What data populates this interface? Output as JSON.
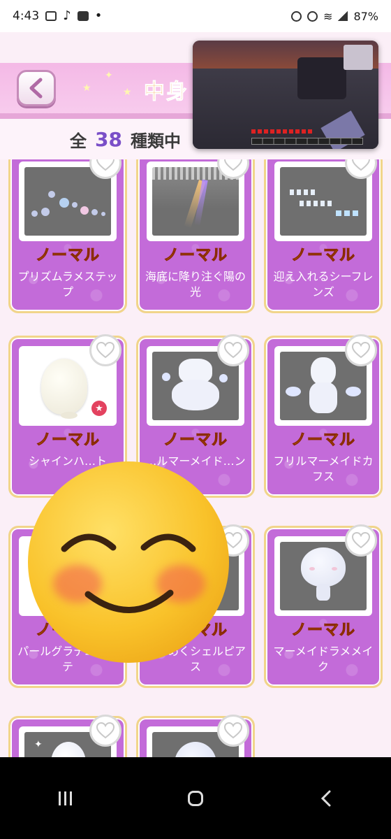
{
  "status_bar": {
    "time": "4:43",
    "battery": "87%",
    "icons": [
      "gallery-icon",
      "tiktok-icon",
      "youtube-icon",
      "dot-icon",
      "alarm-icon",
      "mute-icon",
      "wifi-icon",
      "signal-icon"
    ]
  },
  "header": {
    "title": "中身",
    "back_icon": "chevron-left-icon"
  },
  "count_row": {
    "prefix": "全",
    "total": "38",
    "suffix": "種類中"
  },
  "cards": [
    {
      "rarity": "ノーマル",
      "name": "プリズムラメステップ",
      "thumb": "bubbles"
    },
    {
      "rarity": "ノーマル",
      "name": "海底に降り注ぐ陽の光",
      "thumb": "light"
    },
    {
      "rarity": "ノーマル",
      "name": "迎え入れるシーフレンズ",
      "thumb": "fish"
    },
    {
      "rarity": "ノーマル",
      "name": "シャインハ…ト",
      "thumb": "egg",
      "favorite": true
    },
    {
      "rarity": "ノーマル",
      "name": "…ルマーメイド…ン",
      "thumb": "mermaid"
    },
    {
      "rarity": "ノーマル",
      "name": "フリルマーメイドカフス",
      "thumb": "cuffs"
    },
    {
      "rarity": "ノーマル",
      "name": "パールグラデエクステ",
      "thumb": "hidden"
    },
    {
      "rarity": "ノーマル",
      "name": "きらめくシェルピアス",
      "thumb": "hidden"
    },
    {
      "rarity": "ノーマル",
      "name": "マーメイドラメメイク",
      "thumb": "face"
    },
    {
      "rarity": "",
      "name": "",
      "thumb": "egg-sparkle"
    },
    {
      "rarity": "",
      "name": "",
      "thumb": "head"
    }
  ],
  "overlays": {
    "video": "minecraft-gameplay-overlay",
    "emoji": "smiling-face-emoji"
  },
  "nav": {
    "recent": "recent-apps-icon",
    "home": "home-icon",
    "back": "back-icon"
  },
  "colors": {
    "card_bg": "#c36bd9",
    "card_border": "#f1d58a",
    "rarity_text": "#f6c21d",
    "count_accent": "#7a4fc8",
    "header_bg": "#f4b9e6",
    "title_color": "#f08b1a"
  }
}
